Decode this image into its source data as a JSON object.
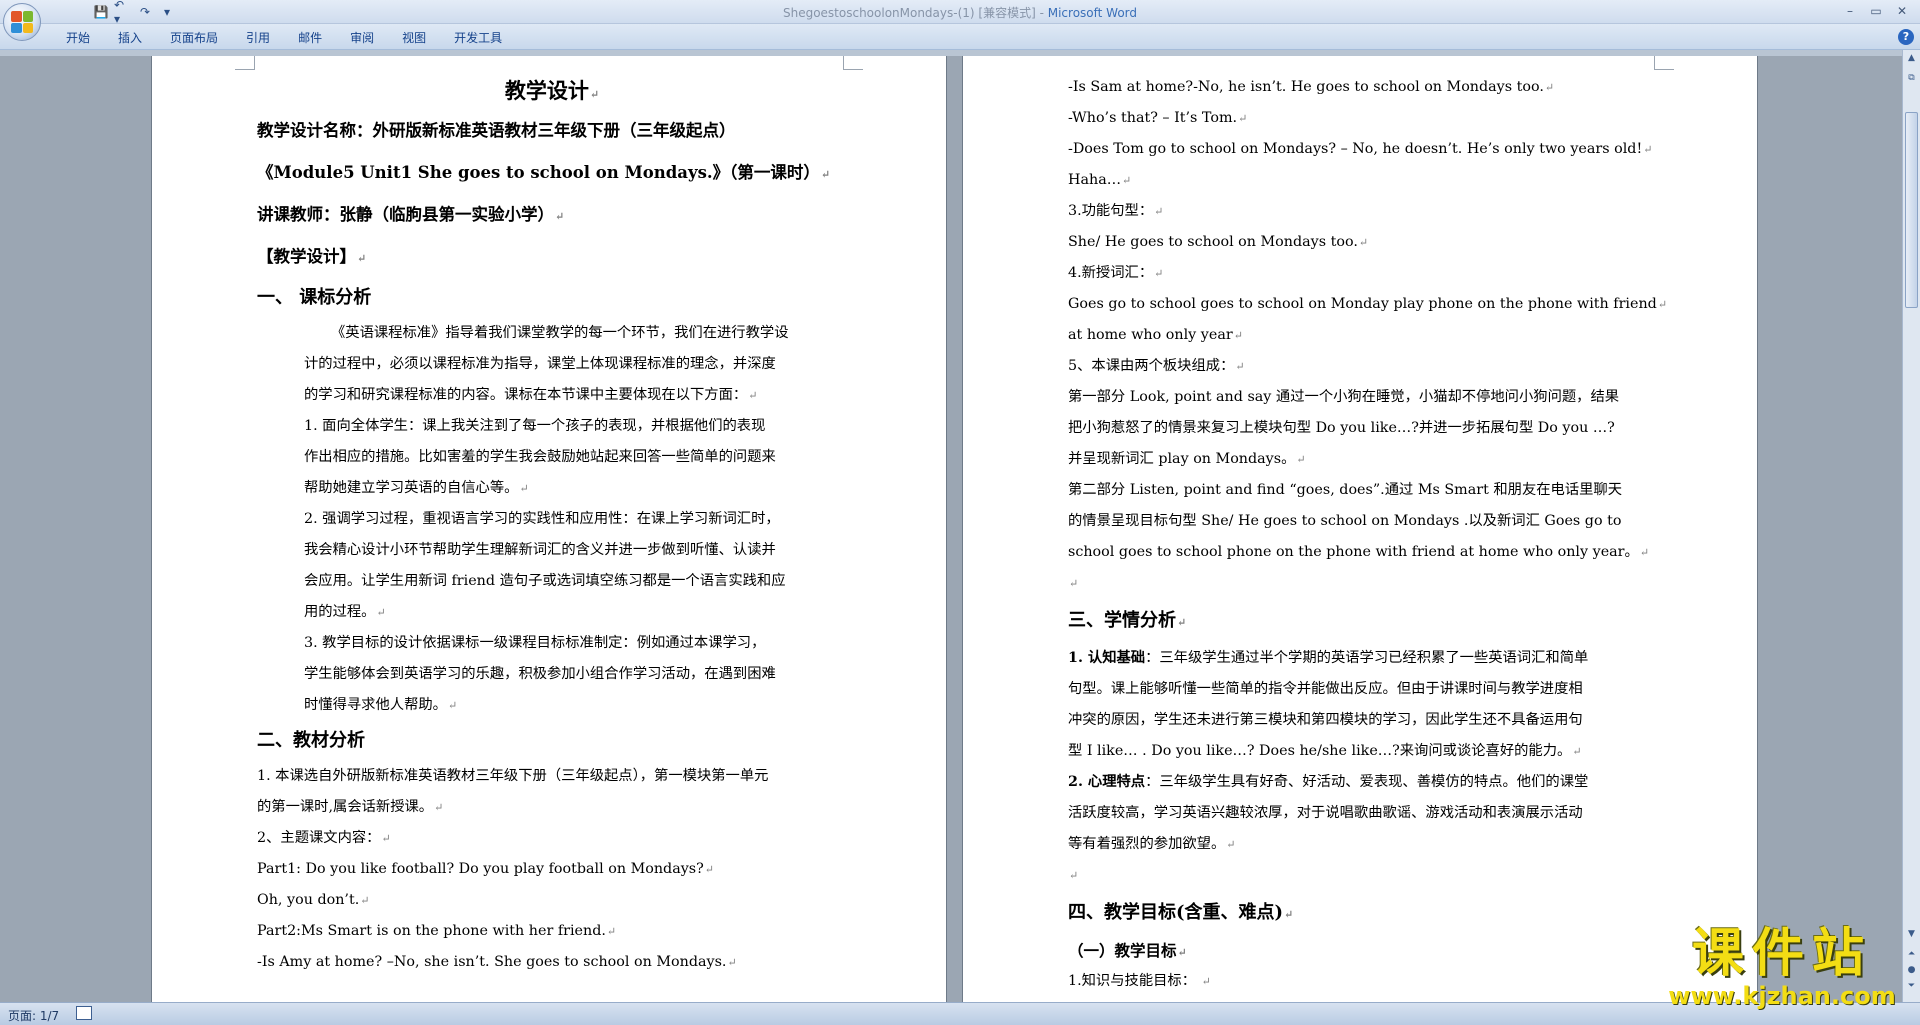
{
  "window": {
    "title_doc": "ShegoestoschoolonMondays-(1) [兼容模式] - ",
    "title_app": "Microsoft Word"
  },
  "quick_access": {
    "save_icon": "save-icon",
    "undo": "↶ ▾",
    "redo": "↷",
    "more": "▾"
  },
  "window_controls": {
    "minimize": "–",
    "maximize": "▭",
    "close": "✕"
  },
  "ribbon": {
    "tabs": [
      "开始",
      "插入",
      "页面布局",
      "引用",
      "邮件",
      "审阅",
      "视图",
      "开发工具"
    ],
    "help": "?"
  },
  "page_left": {
    "title": "教学设计",
    "name_line": "教学设计名称：外研版新标准英语教材三年级下册（三年级起点）",
    "module_line": "《Module5 Unit1 She goes to school on Mondays.》（第一课时）",
    "teacher_line": "讲课教师：张静（临朐县第一实验小学）",
    "design_header": "【教学设计】",
    "section1": "一、  课标分析",
    "s1_para": [
      "《英语课程标准》指导着我们课堂教学的每一个环节，我们在进行教学设",
      "计的过程中，必须以课程标准为指导，课堂上体现课程标准的理念，并深度",
      "的学习和研究课程标准的内容。课标在本节课中主要体现在以下方面："
    ],
    "item1": [
      "1.      面向全体学生：课上我关注到了每一个孩子的表现，并根据他们的表现",
      "作出相应的措施。比如害羞的学生我会鼓励她站起来回答一些简单的问题来",
      "帮助她建立学习英语的自信心等。"
    ],
    "item2": [
      "2.      强调学习过程，重视语言学习的实践性和应用性：在课上学习新词汇时，",
      "我会精心设计小环节帮助学生理解新词汇的含义并进一步做到听懂、认读并",
      "会应用。让学生用新词  friend  造句子或选词填空练习都是一个语言实践和应",
      "用的过程。"
    ],
    "item3": [
      "3.      教学目标的设计依据课标一级课程目标标准制定：例如通过本课学习，",
      "学生能够体会到英语学习的乐趣，积极参加小组合作学习活动，在遇到困难",
      "时懂得寻求他人帮助。"
    ],
    "section2": "二、教材分析",
    "s2_lines": [
      "1. 本课选自外研版新标准英语教材三年级下册（三年级起点），第一模块第一单元",
      "的第一课时,属会话新授课。",
      "2、主题课文内容：",
      "  Part1: Do you like football? Do you play football on Mondays?",
      "  Oh, you don’t.",
      "Part2:Ms Smart is on the phone with her friend.",
      "-Is Amy at home? –No, she isn’t. She goes to school on Mondays."
    ]
  },
  "page_right": {
    "lines_a": [
      "-Is Sam at home?-No, he isn’t. He goes to school on Mondays too.",
      "-Who’s that? – It’s Tom.",
      "-Does Tom go to school on Mondays? – No, he doesn’t. He’s only two years old!",
      "Haha…",
      "3.功能句型：",
      "She/ He goes to school on Mondays too.",
      "4.新授词汇：",
      "Goes go to school    goes to school on Monday play phone on the phone with friend",
      "  at home who only year",
      "5、本课由两个板块组成：",
      "第一部分 Look, point and say 通过一个小狗在睡觉，小猫却不停地问小狗问题，结果",
      "把小狗惹怒了的情景来复习上模块句型 Do you like…?并进一步拓展句型 Do you  …?",
      "并呈现新词汇 play on Mondays。",
      "    第二部分 Listen, point and find “goes, does”.通过 Ms Smart 和朋友在电话里聊天",
      "的情景呈现目标句型  She/  He  goes  to  school  on  Mondays  .以及新词汇  Goes  go  to",
      "school    goes to school phone on the phone with friend at home who only year。",
      ""
    ],
    "section3": "三、学情分析",
    "s3_a_label": "1. 认知基础",
    "s3_a_lines": [
      "：三年级学生通过半个学期的英语学习已经积累了一些英语词汇和简单",
      "句型。课上能够听懂一些简单的指令并能做出反应。但由于讲课时间与教学进度相",
      "冲突的原因，学生还未进行第三模块和第四模块的学习，因此学生还不具备运用句",
      "型 I like… . Do you like…? Does he/she like…?来询问或谈论喜好的能力。"
    ],
    "s3_b_label": "2. 心理特点",
    "s3_b_lines": [
      "：三年级学生具有好奇、好活动、爱表现、善模仿的特点。他们的课堂",
      "活跃度较高，学习英语兴趣较浓厚，对于说唱歌曲歌谣、游戏活动和表演展示活动",
      "等有着强烈的参加欲望。",
      ""
    ],
    "section4": " 四、教学目标(含重、难点)",
    "sub4": "（一）教学目标",
    "goal1": "1.知识与技能目标：      "
  },
  "paragraph_mark": "↵",
  "statusbar": {
    "page": "页面: 1/7"
  },
  "watermark": {
    "main": "课件站",
    "url": "www.kjzhan.com"
  },
  "colors": {
    "ribbon_text": "#15428b",
    "watermark": "#f3dd14",
    "title_app": "#3a6fb8"
  }
}
